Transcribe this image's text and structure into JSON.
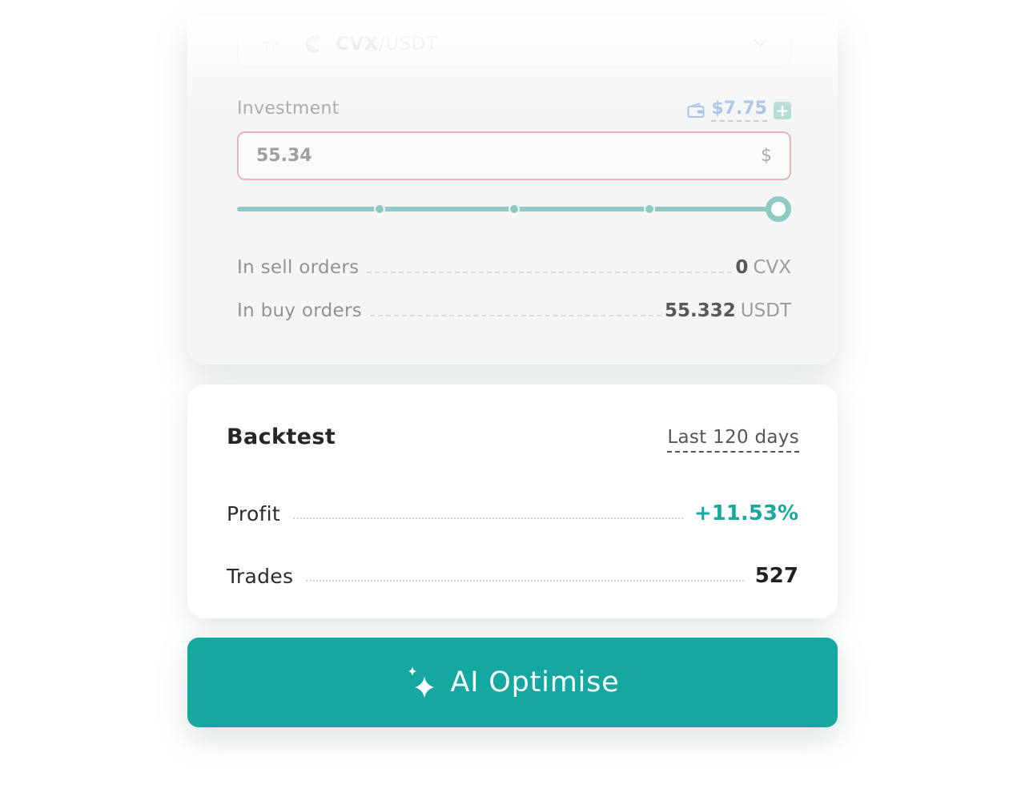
{
  "pair_selector": {
    "base": "CVX",
    "separator": "/",
    "quote": "USDT",
    "icons": [
      "star-icon",
      "cvx-coin-icon",
      "chevron-down-icon"
    ]
  },
  "investment": {
    "label": "Investment",
    "balance": "$7.75",
    "value": "55.34",
    "currency_symbol": "$",
    "slider_percent": 100,
    "slider_ticks": [
      25,
      50,
      75
    ]
  },
  "orders": {
    "sell": {
      "label": "In sell orders",
      "amount": "0",
      "unit": "CVX"
    },
    "buy": {
      "label": "In buy orders",
      "amount": "55.332",
      "unit": "USDT"
    }
  },
  "backtest": {
    "title": "Backtest",
    "period": "Last 120 days",
    "profit": {
      "label": "Profit",
      "value": "+11.53%"
    },
    "trades": {
      "label": "Trades",
      "value": "527"
    }
  },
  "ai_button": {
    "label": "AI Optimise"
  },
  "colors": {
    "accent": "#14a8a0",
    "profit": "#17a89e",
    "input_border_error": "#eab3b3",
    "slider": "#8fcac2",
    "balance_link": "#a9c3e6"
  }
}
